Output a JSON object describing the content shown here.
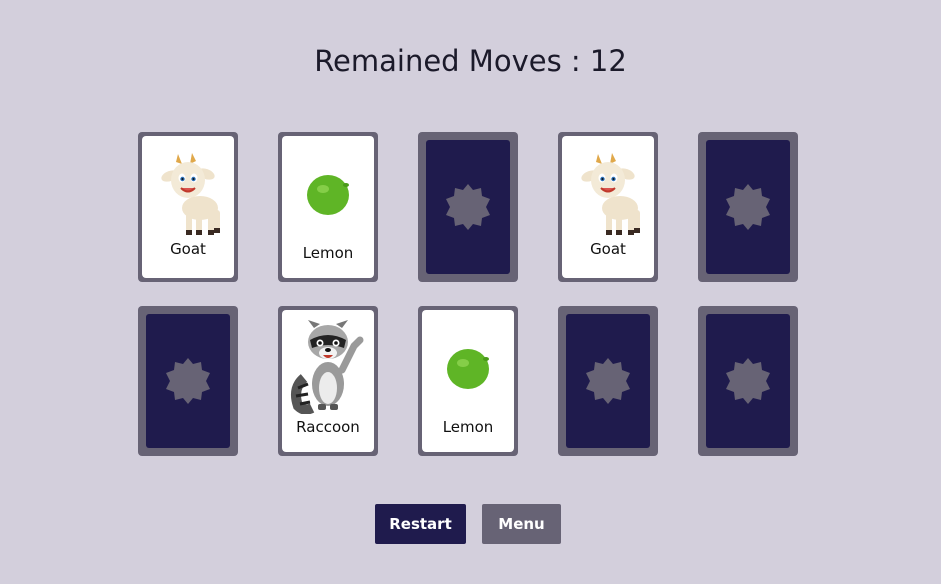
{
  "header": {
    "moves_label": "Remained Moves : 12"
  },
  "board": {
    "rows": [
      [
        {
          "state": "face-up",
          "label": "Goat",
          "icon": "goat-icon"
        },
        {
          "state": "face-up",
          "label": "Lemon",
          "icon": "lemon-icon"
        },
        {
          "state": "face-down",
          "icon": "card-back-star-icon"
        },
        {
          "state": "face-up",
          "label": "Goat",
          "icon": "goat-icon"
        },
        {
          "state": "face-down",
          "icon": "card-back-star-icon"
        }
      ],
      [
        {
          "state": "face-down",
          "icon": "card-back-star-icon"
        },
        {
          "state": "face-up",
          "label": "Raccoon",
          "icon": "raccoon-icon"
        },
        {
          "state": "face-up",
          "label": "Lemon",
          "icon": "lemon-icon"
        },
        {
          "state": "face-down",
          "icon": "card-back-star-icon"
        },
        {
          "state": "face-down",
          "icon": "card-back-star-icon"
        }
      ]
    ]
  },
  "controls": {
    "restart_label": "Restart",
    "menu_label": "Menu"
  },
  "colors": {
    "background": "#d3cfdc",
    "card_border": "#676375",
    "card_back": "#1f1b4d",
    "lemon": "#5fb526",
    "primary_button": "#1f1b4d",
    "secondary_button": "#676375"
  }
}
